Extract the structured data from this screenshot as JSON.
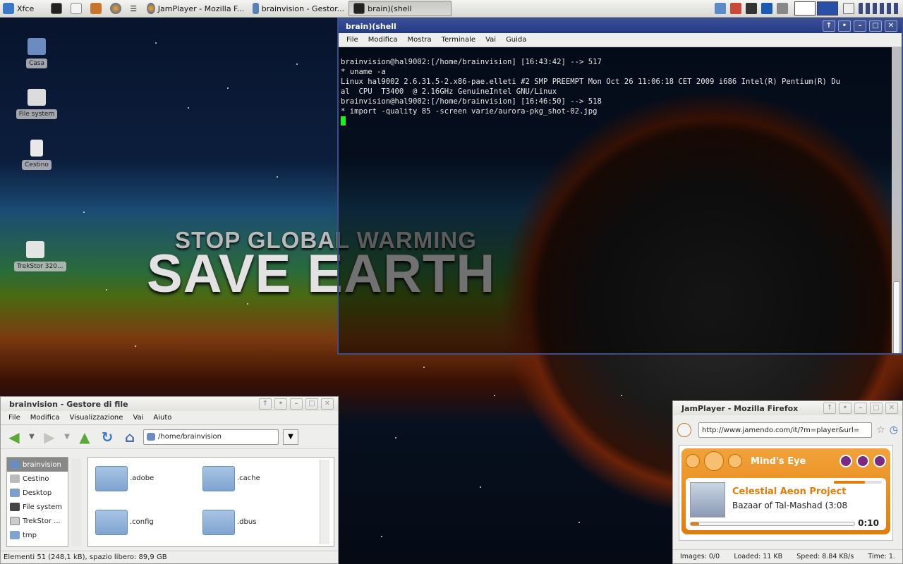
{
  "top_panel": {
    "menu_label": "Xfce",
    "tasks": [
      {
        "label": "JamPlayer - Mozilla F...",
        "active": false
      },
      {
        "label": "brainvision - Gestor...",
        "active": false
      },
      {
        "label": "brain)(shell",
        "active": true
      }
    ]
  },
  "wallpaper": {
    "slogan_top": "STOP GLOBAL WARMING",
    "slogan_main": "SAVE EARTH"
  },
  "desktop_icons": [
    "Casa",
    "File system",
    "Cestino",
    "TrekStor 320..."
  ],
  "terminal": {
    "title": "brain)(shell",
    "menu": [
      "File",
      "Modifica",
      "Mostra",
      "Terminale",
      "Vai",
      "Guida"
    ],
    "lines": [
      "brainvision@hal9002:[/home/brainvision] [16:43:42] --> 517",
      "* uname -a",
      "Linux hal9002 2.6.31.5-2.x86-pae.elleti #2 SMP PREEMPT Mon Oct 26 11:06:18 CET 2009 i686 Intel(R) Pentium(R) Du",
      "al  CPU  T3400  @ 2.16GHz GenuineIntel GNU/Linux",
      "",
      "brainvision@hal9002:[/home/brainvision] [16:46:50] --> 518",
      "* import -quality 85 -screen varie/aurora-pkg_shot-02.jpg"
    ]
  },
  "file_manager": {
    "title": "brainvision - Gestore di file",
    "menu": [
      "File",
      "Modifica",
      "Visualizzazione",
      "Vai",
      "Aiuto"
    ],
    "path": "/home/brainvision",
    "sidebar": [
      "brainvision",
      "Cestino",
      "Desktop",
      "File system",
      "TrekStor ...",
      "tmp"
    ],
    "folders": [
      ".adobe",
      ".cache",
      ".config",
      ".dbus"
    ],
    "status": "Elementi 51 (248,1 kB), spazio libero: 89,9 GB"
  },
  "firefox": {
    "title": "JamPlayer - Mozilla Firefox",
    "url": "http://www.jamendo.com/it/?m=player&url=",
    "player": {
      "track_title": "Mind's Eye",
      "artist": "Celestial Aeon Project",
      "song": "Bazaar of Tal-Mashad",
      "duration_partial": "(3:08",
      "elapsed": "0:10",
      "progress_fraction": 0.05,
      "volume_fraction": 0.65
    },
    "status": {
      "images": "Images: 0/0",
      "loaded": "Loaded: 11 KB",
      "speed": "Speed: 8.84 KB/s",
      "time": "Time: 1."
    }
  }
}
